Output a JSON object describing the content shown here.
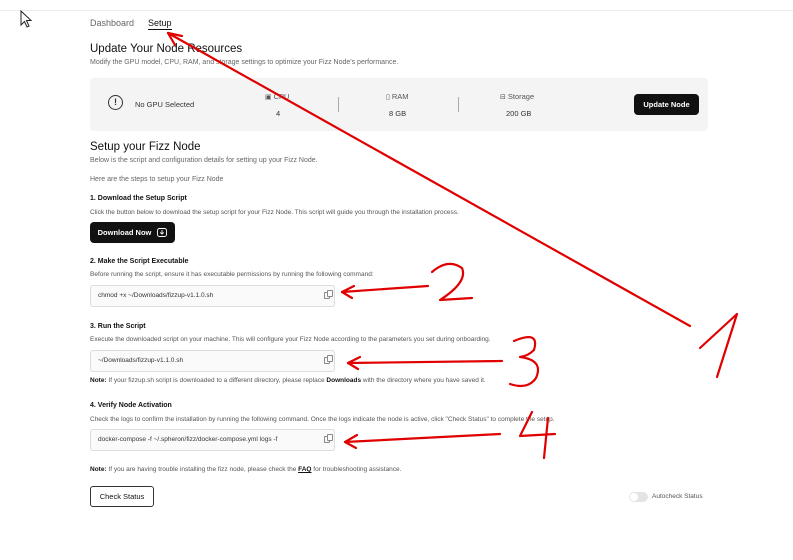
{
  "tabs": [
    {
      "label": "Dashboard",
      "active": false
    },
    {
      "label": "Setup",
      "active": true
    }
  ],
  "resources": {
    "title": "Update Your Node Resources",
    "subtitle": "Modify the GPU model, CPU, RAM, and storage settings to optimize your Fizz Node's performance.",
    "gpu_status": "No GPU Selected",
    "cpu": {
      "label": "CPU",
      "value": "4",
      "icon": "cpu-icon"
    },
    "ram": {
      "label": "RAM",
      "value": "8 GB",
      "icon": "ram-icon"
    },
    "storage": {
      "label": "Storage",
      "value": "200 GB",
      "icon": "storage-icon"
    },
    "update_button": "Update Node"
  },
  "setup": {
    "title": "Setup your Fizz Node",
    "subtitle": "Below is the script and configuration details for setting up your Fizz Node.",
    "intro": "Here are the steps to setup your Fizz Node",
    "steps": [
      {
        "title": "1. Download the Setup Script",
        "desc": "Click the button below to download the setup script for your Fizz Node. This script will guide you through the installation process.",
        "button": "Download Now"
      },
      {
        "title": "2. Make the Script Executable",
        "desc": "Before running the script, ensure it has executable permissions by running the following command:",
        "code": "chmod +x ~/Downloads/fizzup-v1.1.0.sh"
      },
      {
        "title": "3. Run the Script",
        "desc": "Execute the downloaded script on your machine. This will configure your Fizz Node according to the parameters you set during onboarding.",
        "code": "~/Downloads/fizzup-v1.1.0.sh",
        "note_label": "Note:",
        "note_pre": " If your fizzup.sh script is downloaded to a different directory, please replace ",
        "note_bold": "Downloads",
        "note_post": " with the directory where you have saved it."
      },
      {
        "title": "4. Verify Node Activation",
        "desc": "Check the logs to confirm the installation by running the following command. Once the logs indicate the node is active, click \"Check Status\" to complete the setup.",
        "code": "docker-compose -f ~/.spheron/fizz/docker-compose.yml logs -f"
      }
    ],
    "trouble_note_label": "Note:",
    "trouble_note_pre": " If you are having trouble installing the fizz node, please check the ",
    "trouble_note_link": "FAQ",
    "trouble_note_post": " for troubleshooting assistance.",
    "check_status_button": "Check Status",
    "autocheck_label": "Autocheck Status",
    "autocheck_on": false
  },
  "annotations": {
    "color": "#e00000",
    "marks": [
      "1",
      "2",
      "3",
      "4"
    ]
  }
}
